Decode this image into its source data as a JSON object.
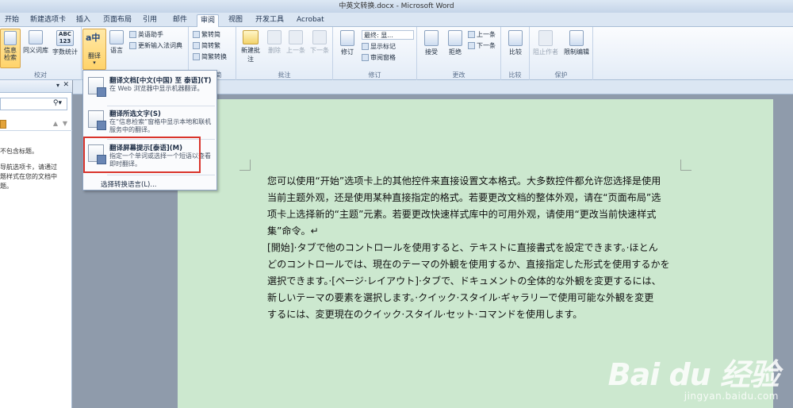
{
  "window": {
    "title": "中英文转换.docx - Microsoft Word"
  },
  "tabs": [
    "开始",
    "新建选项卡",
    "插入",
    "页面布局",
    "引用",
    "邮件",
    "审阅",
    "视图",
    "开发工具",
    "Acrobat"
  ],
  "ribbon": {
    "proofing": {
      "label": "校对",
      "info_search": "信息检索",
      "thesaurus": "同义词库",
      "word_count": "字数统计",
      "word_count_icon": "ABC\n123"
    },
    "language": {
      "translate": "翻译",
      "language": "语言",
      "english_assistant": "英语助手",
      "update_ime": "更新输入法词典"
    },
    "chinese_conv": {
      "label": "繁转简",
      "trad_to_simp": "繁转简",
      "simp_to_trad": "简转繁",
      "conversion": "简繁转换"
    },
    "comments": {
      "label": "批注",
      "new": "新建批注",
      "delete": "删除",
      "prev": "上一条",
      "next": "下一条"
    },
    "tracking": {
      "label": "修订",
      "track": "修订",
      "final": "最终: 显...",
      "show_markup": "显示标记",
      "review_pane": "审阅窗格"
    },
    "changes": {
      "label": "更改",
      "accept": "接受",
      "reject": "拒绝",
      "prev": "上一条",
      "next": "下一条"
    },
    "compare": {
      "label": "比较",
      "compare": "比较"
    },
    "protect": {
      "label": "保护",
      "block_authors": "阻止作者",
      "restrict": "限制编辑"
    }
  },
  "nav_pane": {
    "lines": [
      "不包含标题。",
      "导航选项卡，请通过",
      "题样式在您的文档中",
      "题。"
    ]
  },
  "translate_menu": {
    "items": [
      {
        "title": "翻译文档[中文(中国) 至 泰语](T)",
        "desc": "在 Web 浏览器中显示机器翻译。"
      },
      {
        "title": "翻译所选文字(S)",
        "desc": "在“信息检索”窗格中显示本地和联机服务中的翻译。"
      },
      {
        "title": "翻译屏幕提示[泰语](M)",
        "desc": "指定一个单词或选择一个短语以查看即时翻译。"
      }
    ],
    "choose_language": "选择转换语言(L)..."
  },
  "document": {
    "lines": [
      "您可以使用“开始”选项卡上的其他控件来直接设置文本格式。大多数控件都允许您选择是使用",
      "当前主题外观，还是使用某种直接指定的格式。若要更改文档的整体外观，请在“页面布局”选",
      "项卡上选择新的“主题”元素。若要更改快速样式库中的可用外观，请使用“更改当前快速样式",
      "集”命令。↵",
      "[開始]·タブで他のコントロールを使用すると、テキストに直接書式を設定できます。·ほとん",
      "どのコントロールでは、現在のテーマの外観を使用するか、直接指定した形式を使用するかを",
      "選択できます。·[ページ·レイアウト]·タブで、ドキュメントの全体的な外観を変更するには、",
      "新しいテーマの要素を選択します。·クイック·スタイル·ギャラリーで使用可能な外観を変更",
      "するには、変更現在のクイック·スタイル·セット·コマンドを使用します。"
    ]
  },
  "watermark": {
    "brand": "Bai du 经验",
    "url": "jingyan.baidu.com"
  }
}
